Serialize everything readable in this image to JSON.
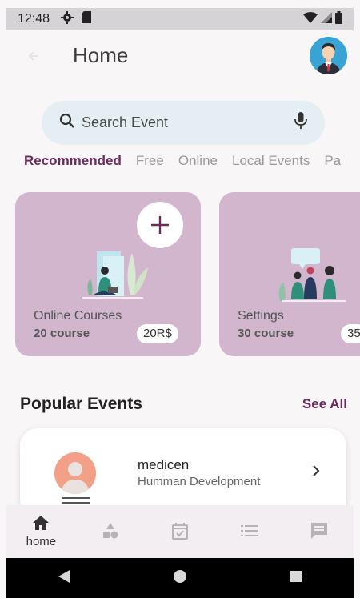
{
  "status": {
    "time": "12:48"
  },
  "appbar": {
    "title": "Home"
  },
  "search": {
    "placeholder": "Search Event"
  },
  "tabs": [
    "Recommended",
    "Free",
    "Online",
    "Local Events",
    "Pa"
  ],
  "cards": [
    {
      "name": "Online Courses",
      "count": "20 course",
      "price": "20R$"
    },
    {
      "name": "Settings",
      "count": "30 course",
      "price": "35"
    }
  ],
  "popular": {
    "title": "Popular Events",
    "see_all": "See All"
  },
  "event": {
    "title": "medicen",
    "subtitle": "Humman Development"
  },
  "bottom_nav": {
    "home_label": "home"
  },
  "colors": {
    "accent": "#6b2a5c",
    "card": "#d1b6ce",
    "search_bg": "#e5eef2"
  }
}
